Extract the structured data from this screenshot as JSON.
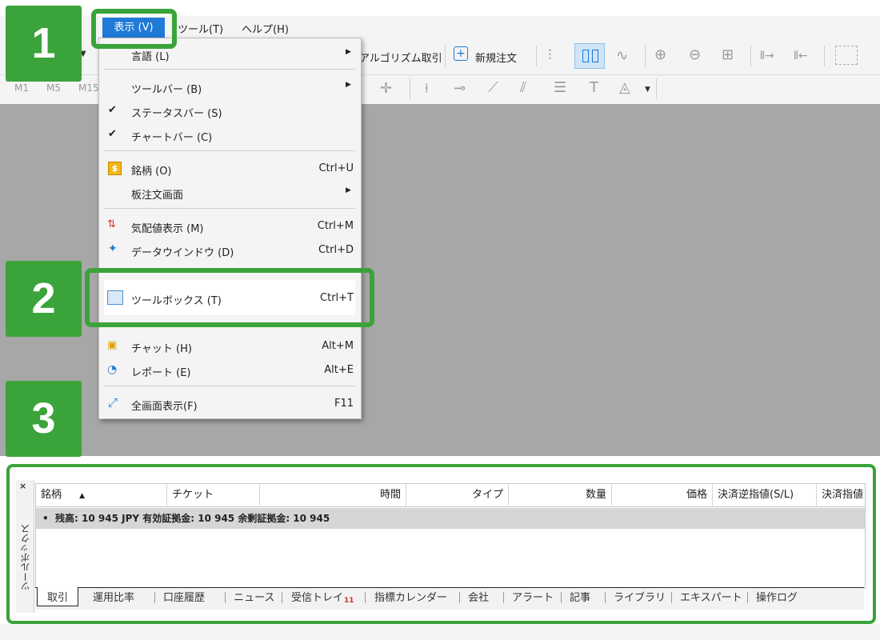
{
  "menubar": {
    "view": "表示 (V)",
    "tools": "ツール(T)",
    "help": "ヘルプ(H)"
  },
  "toolbar": {
    "algo_trading": "アルゴリズム取引",
    "new_order": "新規注文",
    "timeframes": [
      "M1",
      "M5",
      "M15"
    ]
  },
  "view_menu": {
    "items": [
      {
        "label": "言語 (L)",
        "shortcut": "",
        "submenu": true,
        "checked": false,
        "icon": ""
      },
      {
        "label": "ツールバー (B)",
        "shortcut": "",
        "submenu": true,
        "checked": false,
        "icon": ""
      },
      {
        "label": "ステータスバー (S)",
        "shortcut": "",
        "submenu": false,
        "checked": true,
        "icon": ""
      },
      {
        "label": "チャートバー (C)",
        "shortcut": "",
        "submenu": false,
        "checked": true,
        "icon": ""
      },
      {
        "label": "銘柄 (O)",
        "shortcut": "Ctrl+U",
        "submenu": false,
        "checked": false,
        "icon": "symbols-icon"
      },
      {
        "label": "板注文画面",
        "shortcut": "",
        "submenu": true,
        "checked": false,
        "icon": ""
      },
      {
        "label": "気配値表示 (M)",
        "shortcut": "Ctrl+M",
        "submenu": false,
        "checked": false,
        "icon": "market-watch-icon"
      },
      {
        "label": "データウインドウ (D)",
        "shortcut": "Ctrl+D",
        "submenu": false,
        "checked": false,
        "icon": "data-window-icon"
      },
      {
        "label": "ツールボックス (T)",
        "shortcut": "Ctrl+T",
        "submenu": false,
        "checked": false,
        "icon": "toolbox-icon"
      },
      {
        "label": "チャット (H)",
        "shortcut": "Alt+M",
        "submenu": false,
        "checked": false,
        "icon": "chat-icon"
      },
      {
        "label": "レポート (E)",
        "shortcut": "Alt+E",
        "submenu": false,
        "checked": false,
        "icon": "report-icon"
      },
      {
        "label": "全画面表示(F)",
        "shortcut": "F11",
        "submenu": false,
        "checked": false,
        "icon": "fullscreen-icon"
      }
    ]
  },
  "steps": [
    "1",
    "2",
    "3"
  ],
  "toolbox": {
    "side_label": "ツールボックス",
    "close": "×",
    "columns": [
      "銘柄",
      "チケット",
      "時間",
      "タイプ",
      "数量",
      "価格",
      "決済逆指値(S/L)",
      "決済指値"
    ],
    "summary": "残高: 10 945 JPY  有効証拠金: 10 945  余剰証拠金: 10 945",
    "tabs": [
      "取引",
      "運用比率",
      "口座履歴",
      "ニュース",
      "受信トレイ",
      "指標カレンダー",
      "会社",
      "アラート",
      "記事",
      "ライブラリ",
      "エキスパート",
      "操作ログ"
    ],
    "inbox_badge": "11"
  },
  "colors": {
    "accent_green": "#3aa33a",
    "menu_highlight": "#1f7ad8",
    "workspace": "#a7a7a7"
  }
}
